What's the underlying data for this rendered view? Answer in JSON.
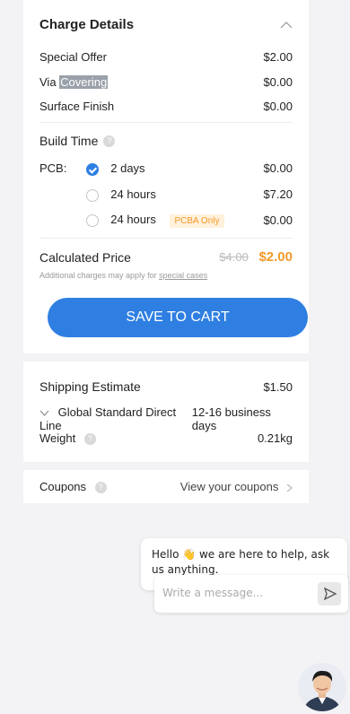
{
  "charge": {
    "title": "Charge Details",
    "rows": [
      {
        "label": "Special Offer",
        "value": "$2.00"
      },
      {
        "label_prefix": "Via ",
        "label_highlight": "Covering",
        "value": "$0.00"
      },
      {
        "label": "Surface Finish",
        "value": "$0.00"
      }
    ]
  },
  "build": {
    "title": "Build Time",
    "pcb_label": "PCB:",
    "options": [
      {
        "label": "2 days",
        "value": "$0.00",
        "selected": true
      },
      {
        "label": "24 hours",
        "value": "$7.20",
        "selected": false
      },
      {
        "label": "24 hours",
        "badge": "PCBA Only",
        "value": "$0.00",
        "selected": false
      }
    ]
  },
  "calculated": {
    "title": "Calculated Price",
    "old_price": "$4.00",
    "new_price": "$2.00",
    "note": "Additional charges may apply for",
    "note_link": "special cases"
  },
  "save_button": "SAVE TO CART",
  "shipping": {
    "title": "Shipping Estimate",
    "price": "$1.50",
    "method": "Global Standard Direct Line",
    "days": "12-16 business days",
    "weight_label": "Weight",
    "weight_value": "0.21kg"
  },
  "coupons": {
    "label": "Coupons",
    "link": "View your coupons"
  },
  "chat": {
    "message": "Hello 👋 we are here to help, ask us anything.",
    "placeholder": "Write a message..."
  },
  "colors": {
    "accent": "#2f7fe2",
    "orange": "#f39a2a",
    "background": "#f3f3f5"
  }
}
